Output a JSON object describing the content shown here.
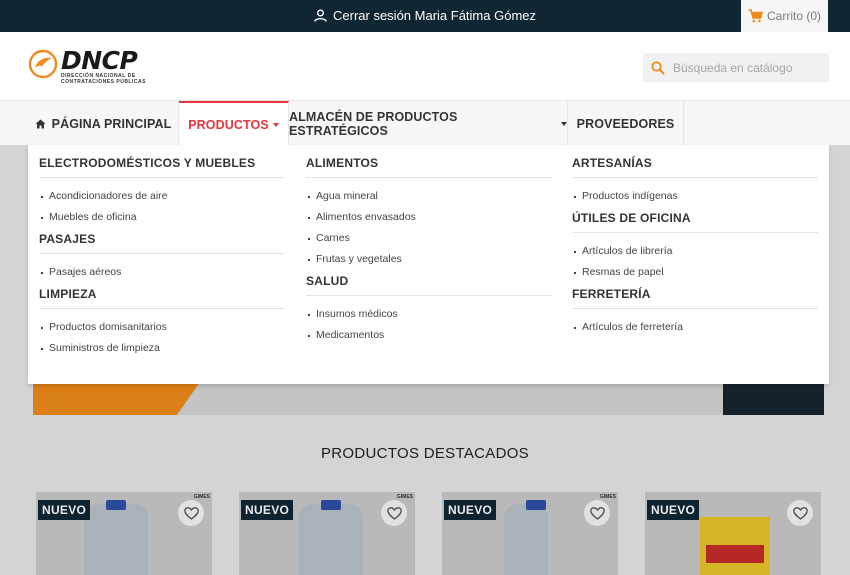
{
  "topbar": {
    "logout_label": "Cerrar sesión Maria Fátima Gómez",
    "cart_label": "Carrito (0)"
  },
  "header": {
    "logo_word": "DNCP",
    "logo_sub_line1": "DIRECCIÓN NACIONAL DE",
    "logo_sub_line2": "CONTRATACIONES PÚBLICAS",
    "search_placeholder": "Búsqueda en catálogo"
  },
  "nav": {
    "items": [
      {
        "label": "PÁGINA PRINCIPAL"
      },
      {
        "label": "PRODUCTOS"
      },
      {
        "label": "ALMACÉN DE PRODUCTOS ESTRATÉGICOS"
      },
      {
        "label": "PROVEEDORES"
      }
    ],
    "active_color": "#e3353c"
  },
  "dropdown": {
    "columns": [
      {
        "categories": [
          {
            "title": "ELECTRODOMÉSTICOS Y MUEBLES",
            "items": [
              "Acondicionadores de aire",
              "Muebles de oficina"
            ]
          },
          {
            "title": "PASAJES",
            "items": [
              "Pasajes aéreos"
            ]
          },
          {
            "title": "LIMPIEZA",
            "items": [
              "Productos domisanitarios",
              "Suministros de limpieza"
            ]
          }
        ]
      },
      {
        "categories": [
          {
            "title": "ALIMENTOS",
            "items": [
              "Agua mineral",
              "Alimentos envasados",
              "Carnes",
              "Frutas y vegetales"
            ]
          },
          {
            "title": "SALUD",
            "items": [
              "Insumos médicos",
              "Medicamentos"
            ]
          }
        ]
      },
      {
        "categories": [
          {
            "title": "ARTESANÍAS",
            "items": [
              "Productos indígenas"
            ]
          },
          {
            "title": "ÚTILES DE OFICINA",
            "items": [
              "Artículos de librería",
              "Resmas de papel"
            ]
          },
          {
            "title": "FERRETERÍA",
            "items": [
              "Artículos de ferretería"
            ]
          }
        ]
      }
    ]
  },
  "featured": {
    "title": "PRODUCTOS DESTACADOS",
    "cards": [
      {
        "badge": "NUEVO",
        "brand": "GIMES"
      },
      {
        "badge": "NUEVO",
        "brand": "GIMES"
      },
      {
        "badge": "NUEVO",
        "brand": "GIMES"
      },
      {
        "badge": "NUEVO",
        "brand": ""
      }
    ]
  },
  "colors": {
    "topbar": "#0f2735",
    "logo_orange": "#f08a1c",
    "accent_red": "#e3353c",
    "search_icon": "#f08a1c"
  }
}
